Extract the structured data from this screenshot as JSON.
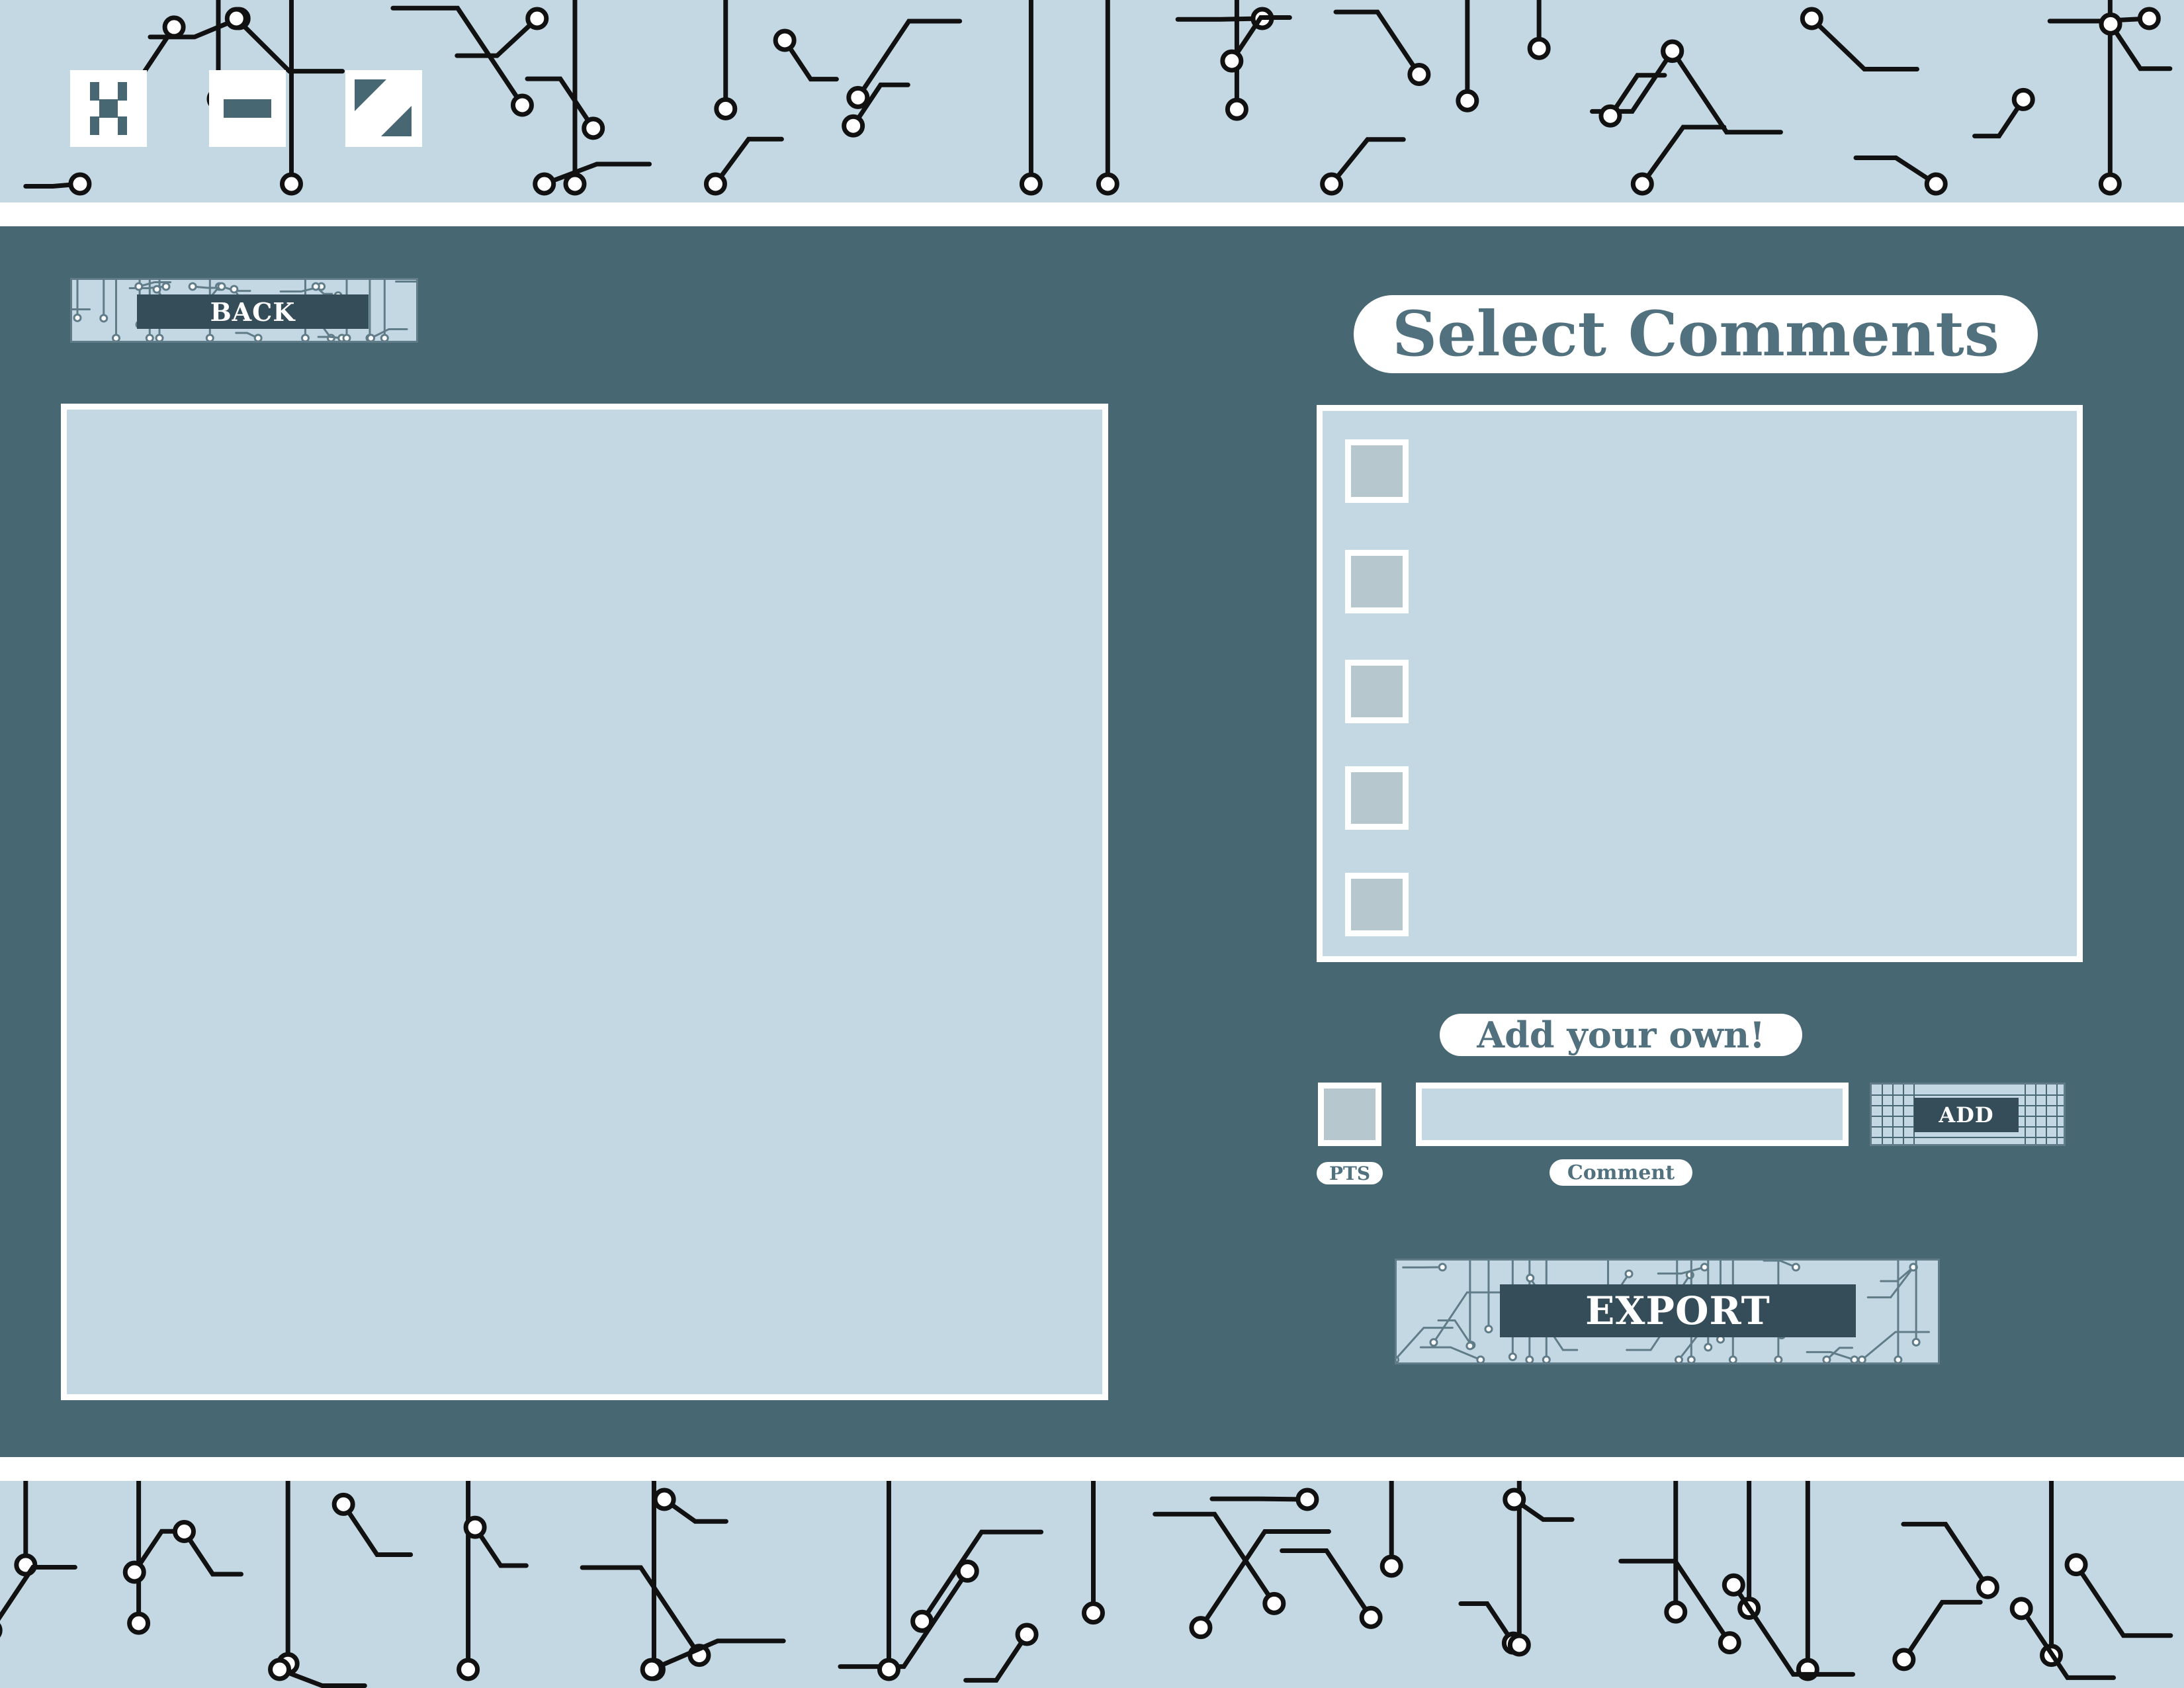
{
  "window_controls": {
    "close_icon": "close-icon",
    "minimize_icon": "minimize-icon",
    "resize_icon": "resize-icon"
  },
  "buttons": {
    "back": "BACK",
    "add": "ADD",
    "export": "EXPORT"
  },
  "comments_panel": {
    "title": "Select Comments",
    "items": [
      {
        "checked": false
      },
      {
        "checked": false
      },
      {
        "checked": false
      },
      {
        "checked": false
      },
      {
        "checked": false
      }
    ]
  },
  "add_section": {
    "title": "Add your own!",
    "pts_label": "PTS",
    "pts_value": "",
    "comment_label": "Comment",
    "comment_value": ""
  },
  "colors": {
    "panel": "#476773",
    "light": "#c4d8e3",
    "dark_label": "#344d59",
    "title_text": "#51717f",
    "checkbox": "#b6c7cd"
  }
}
